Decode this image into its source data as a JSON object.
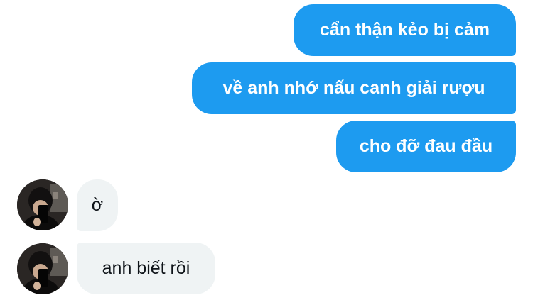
{
  "messages": {
    "sent": [
      {
        "text": "cẩn thận kẻo bị cảm"
      },
      {
        "text": "về anh nhớ nấu canh giải rượu"
      },
      {
        "text": "cho đỡ đau đầu"
      }
    ],
    "received": [
      {
        "text": "ờ",
        "avatar_icon": "profile-photo-icon"
      },
      {
        "text": "anh biết rồi",
        "avatar_icon": "profile-photo-icon"
      }
    ]
  },
  "colors": {
    "sent_bubble": "#1d9bf0",
    "sent_text": "#ffffff",
    "received_bubble": "#eff3f4",
    "received_text": "#0f1419"
  }
}
